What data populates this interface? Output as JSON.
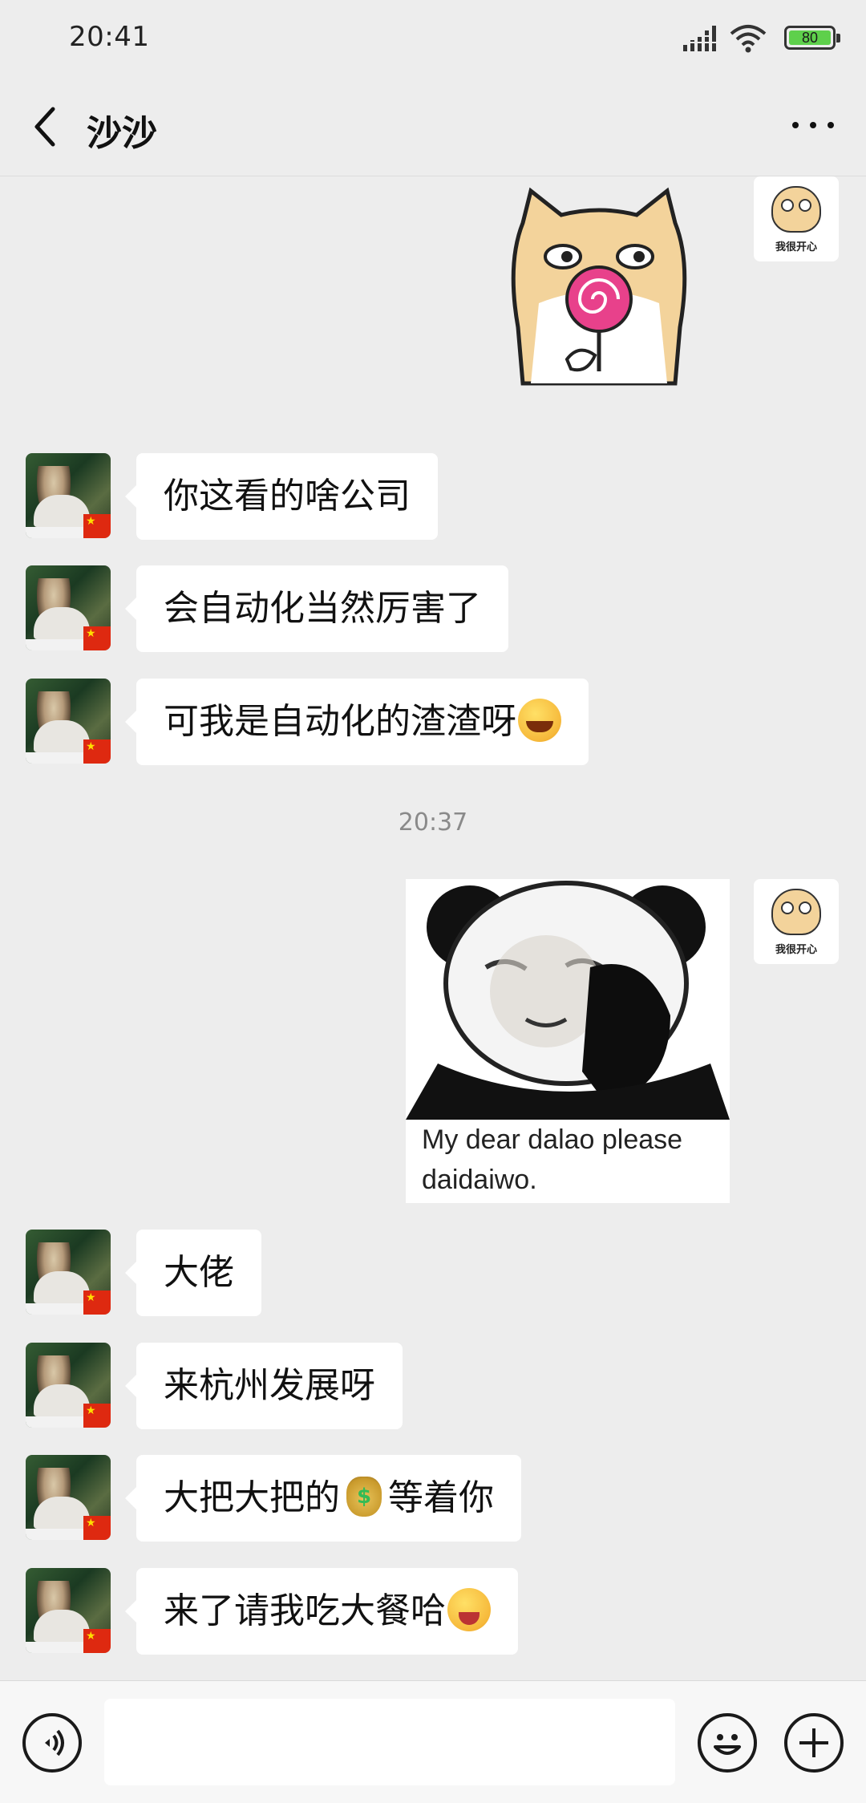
{
  "status_bar": {
    "time": "20:41",
    "battery": "80"
  },
  "header": {
    "back_icon": "chevron-left-icon",
    "title": "沙沙",
    "more_icon": "more-dots-icon"
  },
  "contact": {
    "self_avatar_caption": "我很开心"
  },
  "messages": [
    {
      "from": "self",
      "type": "sticker",
      "sticker": "doge-lollipop"
    },
    {
      "from": "other",
      "type": "text",
      "text": "你这看的啥公司"
    },
    {
      "from": "other",
      "type": "text",
      "text": "会自动化当然厉害了"
    },
    {
      "from": "other",
      "type": "text",
      "text": "可我是自动化的渣渣呀",
      "emoji": "laughing-crying-emoji"
    },
    {
      "type": "timestamp",
      "text": "20:37"
    },
    {
      "from": "self",
      "type": "sticker",
      "sticker": "panda-please",
      "caption_line1": "My dear dalao please",
      "caption_line2": "daidaiwo."
    },
    {
      "from": "other",
      "type": "text",
      "text": "大佬"
    },
    {
      "from": "other",
      "type": "text",
      "text": "来杭州发展呀"
    },
    {
      "from": "other",
      "type": "text",
      "text_before": "大把大把的",
      "emoji": "money-bag-emoji",
      "text_after": "等着你"
    },
    {
      "from": "other",
      "type": "text",
      "text": "来了请我吃大餐哈",
      "emoji": "winking-tongue-emoji"
    }
  ],
  "input_bar": {
    "voice_icon": "voice-icon",
    "input_value": "",
    "emoji_icon": "emoji-face-icon",
    "plus_icon": "plus-icon"
  },
  "colors": {
    "background": "#ededed",
    "bubble_other": "#ffffff",
    "battery_fill": "#5ed04b"
  }
}
